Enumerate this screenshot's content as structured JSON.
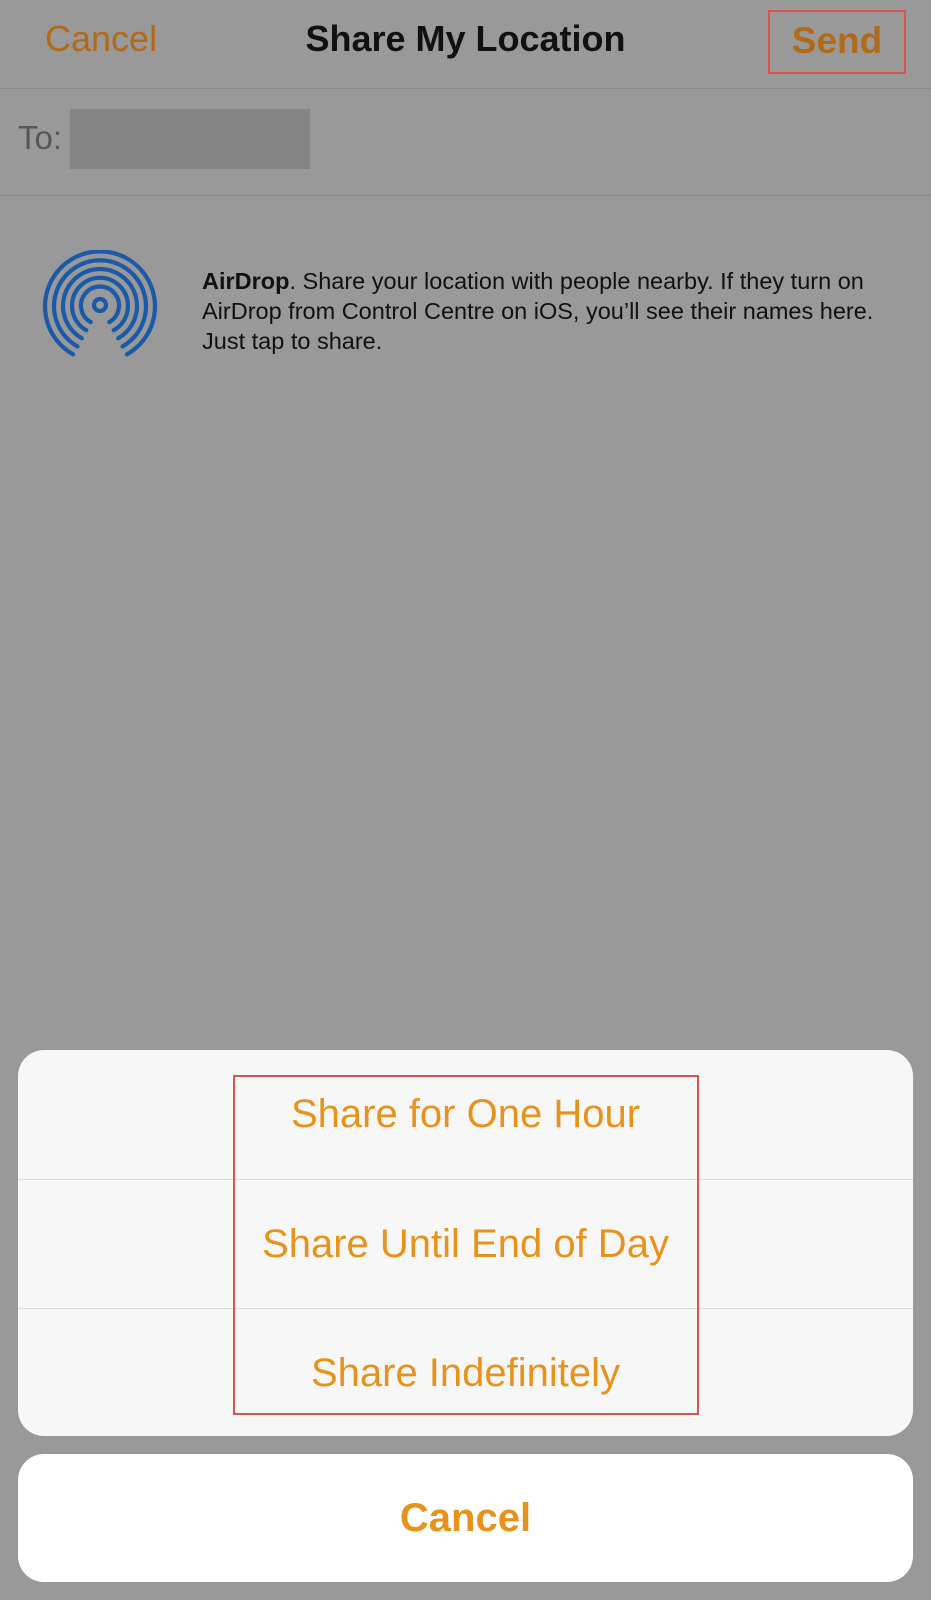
{
  "navbar": {
    "cancel_label": "Cancel",
    "title": "Share My Location",
    "send_label": "Send"
  },
  "to_field": {
    "label": "To:"
  },
  "airdrop": {
    "icon": "airdrop-icon",
    "title": "AirDrop",
    "description": ". Share your location with people nearby. If they turn on AirDrop from Control Centre on iOS, you’ll see their names here. Just tap to share.",
    "icon_color": "#1a5aa8"
  },
  "action_sheet": {
    "options": [
      {
        "label": "Share for One Hour"
      },
      {
        "label": "Share Until End of Day"
      },
      {
        "label": "Share Indefinitely"
      }
    ],
    "cancel_label": "Cancel"
  },
  "colors": {
    "accent": "#e8921c",
    "nav_accent": "#b06a18",
    "highlight": "#d9534f",
    "overlay": "#999999"
  }
}
